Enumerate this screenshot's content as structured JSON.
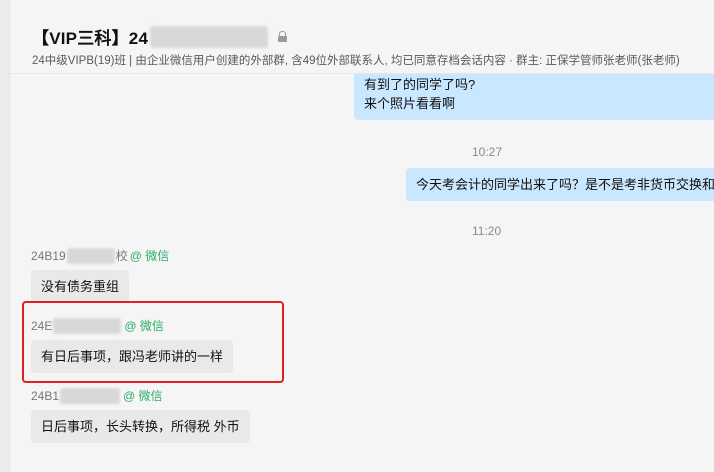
{
  "header": {
    "title": "【VIP三科】24",
    "subtitle": "24中级VIPB(19)班 | 由企业微信用户创建的外部群, 含49位外部联系人, 均已同意存档会话内容 · 群主: 正保学管师张老师(张老师)"
  },
  "messages": {
    "me_1_line1": "有到了的同学了吗?",
    "me_1_line2": "来个照片看看啊",
    "time_1": "10:27",
    "me_2": "今天考会计的同学出来了吗？是不是考非货币交换和",
    "time_2": "11:20",
    "m1": {
      "sender_prefix": "24B19",
      "sender_suffix": "校",
      "source": "@ 微信",
      "text": "没有债务重组"
    },
    "m2": {
      "sender_prefix": "24E",
      "source": "@ 微信",
      "text": "有日后事项，跟冯老师讲的一样"
    },
    "m3": {
      "sender_prefix": "24B1",
      "source": "@ 微信",
      "text": "日后事项，长头转换，所得税 外币"
    }
  },
  "colors": {
    "self_bubble": "#c9e7ff",
    "other_bubble": "#e9e9e9",
    "wechat_green": "#2aae67",
    "highlight": "#e02020"
  }
}
